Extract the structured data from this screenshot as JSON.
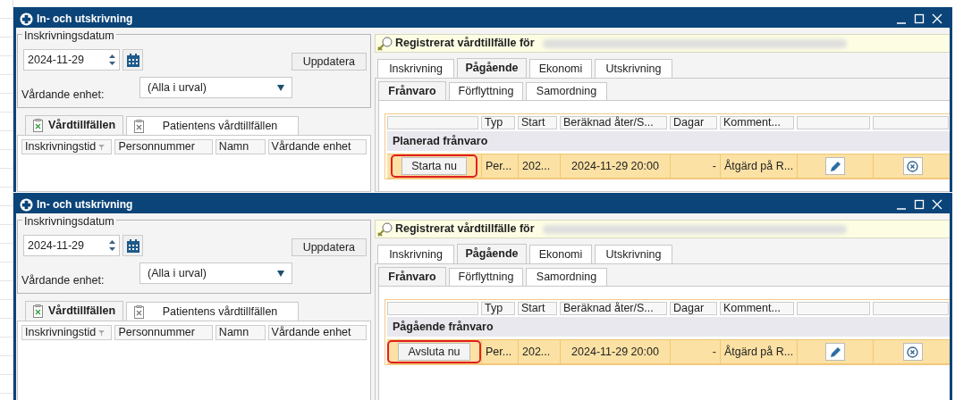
{
  "windows": [
    {
      "title": "In- och utskrivning",
      "date_group": {
        "label": "Inskrivningsdatum",
        "date": "2024-11-29",
        "unit_label": "Vårdande enhet:",
        "unit_value": "(Alla i urval)",
        "update_button": "Uppdatera"
      },
      "left_tabs": [
        {
          "label": "Vårdtillfällen",
          "selected": true
        },
        {
          "label": "Patientens vårdtillfällen",
          "selected": false
        }
      ],
      "left_columns": [
        "Inskrivningstid",
        "Personnummer",
        "Namn",
        "Vårdande enhet"
      ],
      "banner": "Registrerat vårdtillfälle för",
      "tabs": [
        {
          "label": "Inskrivning",
          "selected": false
        },
        {
          "label": "Pågående",
          "selected": true
        },
        {
          "label": "Ekonomi",
          "selected": false
        },
        {
          "label": "Utskrivning",
          "selected": false
        }
      ],
      "subtabs": [
        {
          "label": "Frånvaro",
          "selected": true
        },
        {
          "label": "Förflyttning",
          "selected": false
        },
        {
          "label": "Samordning",
          "selected": false
        }
      ],
      "table": {
        "columns": [
          "Typ",
          "Start",
          "Beräknad åter/S...",
          "Dagar",
          "Komment..."
        ],
        "group_label": "Planerad frånvaro",
        "rows": [
          {
            "action": "Starta nu",
            "action_highlighted": true,
            "cells": [
              "Per...",
              "202...",
              "2024-11-29 20:00",
              "-",
              "Åtgärd på R..."
            ]
          }
        ]
      }
    },
    {
      "title": "In- och utskrivning",
      "date_group": {
        "label": "Inskrivningsdatum",
        "date": "2024-11-29",
        "unit_label": "Vårdande enhet:",
        "unit_value": "(Alla i urval)",
        "update_button": "Uppdatera"
      },
      "left_tabs": [
        {
          "label": "Vårdtillfällen",
          "selected": true
        },
        {
          "label": "Patientens vårdtillfällen",
          "selected": false
        }
      ],
      "left_columns": [
        "Inskrivningstid",
        "Personnummer",
        "Namn",
        "Vårdande enhet"
      ],
      "banner": "Registrerat vårdtillfälle för",
      "tabs": [
        {
          "label": "Inskrivning",
          "selected": false
        },
        {
          "label": "Pågående",
          "selected": true
        },
        {
          "label": "Ekonomi",
          "selected": false
        },
        {
          "label": "Utskrivning",
          "selected": false
        }
      ],
      "subtabs": [
        {
          "label": "Frånvaro",
          "selected": true
        },
        {
          "label": "Förflyttning",
          "selected": false
        },
        {
          "label": "Samordning",
          "selected": false
        }
      ],
      "table": {
        "columns": [
          "Typ",
          "Start",
          "Beräknad åter/S...",
          "Dagar",
          "Komment..."
        ],
        "group_label": "Pågående frånvaro",
        "rows": [
          {
            "action": "Avsluta nu",
            "action_highlighted": true,
            "cells": [
              "Per...",
              "202...",
              "2024-11-29 20:00",
              "-",
              "Åtgärd på R..."
            ]
          }
        ]
      }
    }
  ]
}
